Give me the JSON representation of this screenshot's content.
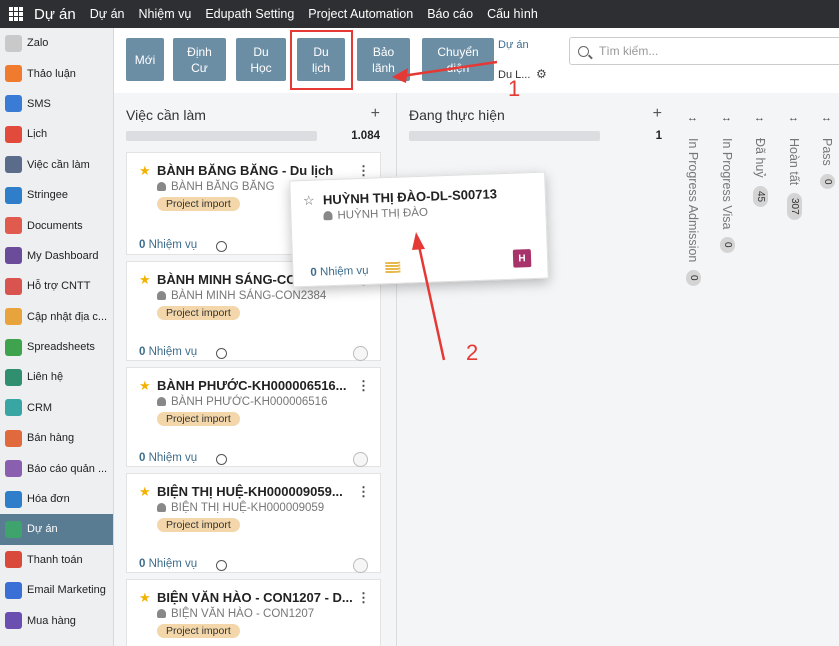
{
  "topbar": {
    "brand": "Dự án",
    "menu": [
      "Dự án",
      "Nhiệm vụ",
      "Edupath Setting",
      "Project Automation",
      "Báo cáo",
      "Cấu hình"
    ]
  },
  "sidebar": {
    "items": [
      {
        "label": "Zalo",
        "icon": "zalo-icon",
        "color": "#c9c9c9"
      },
      {
        "label": "Thảo luận",
        "icon": "discuss-icon",
        "color": "#f07a2e"
      },
      {
        "label": "SMS",
        "icon": "sms-icon",
        "color": "#3a7bd5"
      },
      {
        "label": "Lịch",
        "icon": "calendar-icon",
        "color": "#e24a3b"
      },
      {
        "label": "Việc cần làm",
        "icon": "todo-icon",
        "color": "#5b6b8a"
      },
      {
        "label": "Stringee",
        "icon": "stringee-icon",
        "color": "#2f7ec9"
      },
      {
        "label": "Documents",
        "icon": "documents-icon",
        "color": "#e05a4d"
      },
      {
        "label": "My Dashboard",
        "icon": "dashboard-icon",
        "color": "#6b4c9a"
      },
      {
        "label": "Hỗ trợ CNTT",
        "icon": "helpdesk-icon",
        "color": "#d9534f"
      },
      {
        "label": "Cập nhật địa c...",
        "icon": "map-icon",
        "color": "#e8a33d"
      },
      {
        "label": "Spreadsheets",
        "icon": "spreadsheet-icon",
        "color": "#3fa34d"
      },
      {
        "label": "Liên hệ",
        "icon": "contacts-icon",
        "color": "#2f8f6f"
      },
      {
        "label": "CRM",
        "icon": "crm-icon",
        "color": "#39a6a3"
      },
      {
        "label": "Bán hàng",
        "icon": "sales-icon",
        "color": "#e06a3b"
      },
      {
        "label": "Báo cáo quản ...",
        "icon": "report-icon",
        "color": "#8a5fb0"
      },
      {
        "label": "Hóa đơn",
        "icon": "invoice-icon",
        "color": "#2f7ec9"
      },
      {
        "label": "Dự án",
        "icon": "project-icon",
        "color": "#3fa36d",
        "active": true
      },
      {
        "label": "Thanh toán",
        "icon": "payment-icon",
        "color": "#d94a3b"
      },
      {
        "label": "Email Marketing",
        "icon": "email-marketing-icon",
        "color": "#3a6fd5"
      },
      {
        "label": "Mua hàng",
        "icon": "purchase-icon",
        "color": "#6a4fb0"
      }
    ]
  },
  "control": {
    "stage_buttons": [
      {
        "label": "Mới",
        "name": "stage-moi"
      },
      {
        "label": "Định Cư",
        "name": "stage-dinh-cu"
      },
      {
        "label": "Du Học",
        "name": "stage-du-hoc"
      },
      {
        "label": "Du lịch",
        "name": "stage-du-lich"
      },
      {
        "label": "Bảo lãnh",
        "name": "stage-bao-lanh"
      },
      {
        "label": "Chuyển diện",
        "name": "stage-chuyen-dien"
      }
    ],
    "breadcrumb_root": "Dự án",
    "breadcrumb_current": "Du L...",
    "search_placeholder": "Tìm kiếm..."
  },
  "columns": [
    {
      "title": "Việc cần làm",
      "count": "1.084"
    },
    {
      "title": "Đang thực hiện",
      "count": "1"
    }
  ],
  "cards": [
    {
      "title": "BÀNH BĂNG BĂNG - Du lịch",
      "person": "BÀNH BĂNG BĂNG",
      "tag": "Project import",
      "tasks_count": "0",
      "tasks_label": "Nhiệm vụ"
    },
    {
      "title": "BÀNH MINH SÁNG-CON",
      "person": "BÀNH MINH SÁNG-CON2384",
      "tag": "Project import",
      "tasks_count": "0",
      "tasks_label": "Nhiệm vụ"
    },
    {
      "title": "BÀNH PHƯỚC-KH000006516...",
      "person": "BÀNH PHƯỚC-KH000006516",
      "tag": "Project import",
      "tasks_count": "0",
      "tasks_label": "Nhiệm vụ"
    },
    {
      "title": "BIỆN THỊ HUỆ-KH000009059...",
      "person": "BIỆN THỊ HUỆ-KH000009059",
      "tag": "Project import",
      "tasks_count": "0",
      "tasks_label": "Nhiệm vụ"
    },
    {
      "title": "BIỆN VĂN HÀO - CON1207 - D...",
      "person": "BIỆN VĂN HÀO - CON1207",
      "tag": "Project import",
      "tasks_count": "",
      "tasks_label": ""
    }
  ],
  "drag_card": {
    "title": "HUỲNH THỊ ĐÀO-DL-S00713",
    "person": "HUỲNH THỊ ĐÀO",
    "tasks_count": "0",
    "tasks_label": "Nhiệm vụ",
    "avatar": "H"
  },
  "folded_columns": [
    {
      "label": "In Progress Admission",
      "count": "0"
    },
    {
      "label": "In Progress Visa",
      "count": "0"
    },
    {
      "label": "Đã huỷ",
      "count": "45"
    },
    {
      "label": "Hoàn tất",
      "count": "307"
    },
    {
      "label": "Pass",
      "count": "0"
    }
  ],
  "annotations": {
    "one": "1",
    "two": "2",
    "color": "#e53935"
  }
}
